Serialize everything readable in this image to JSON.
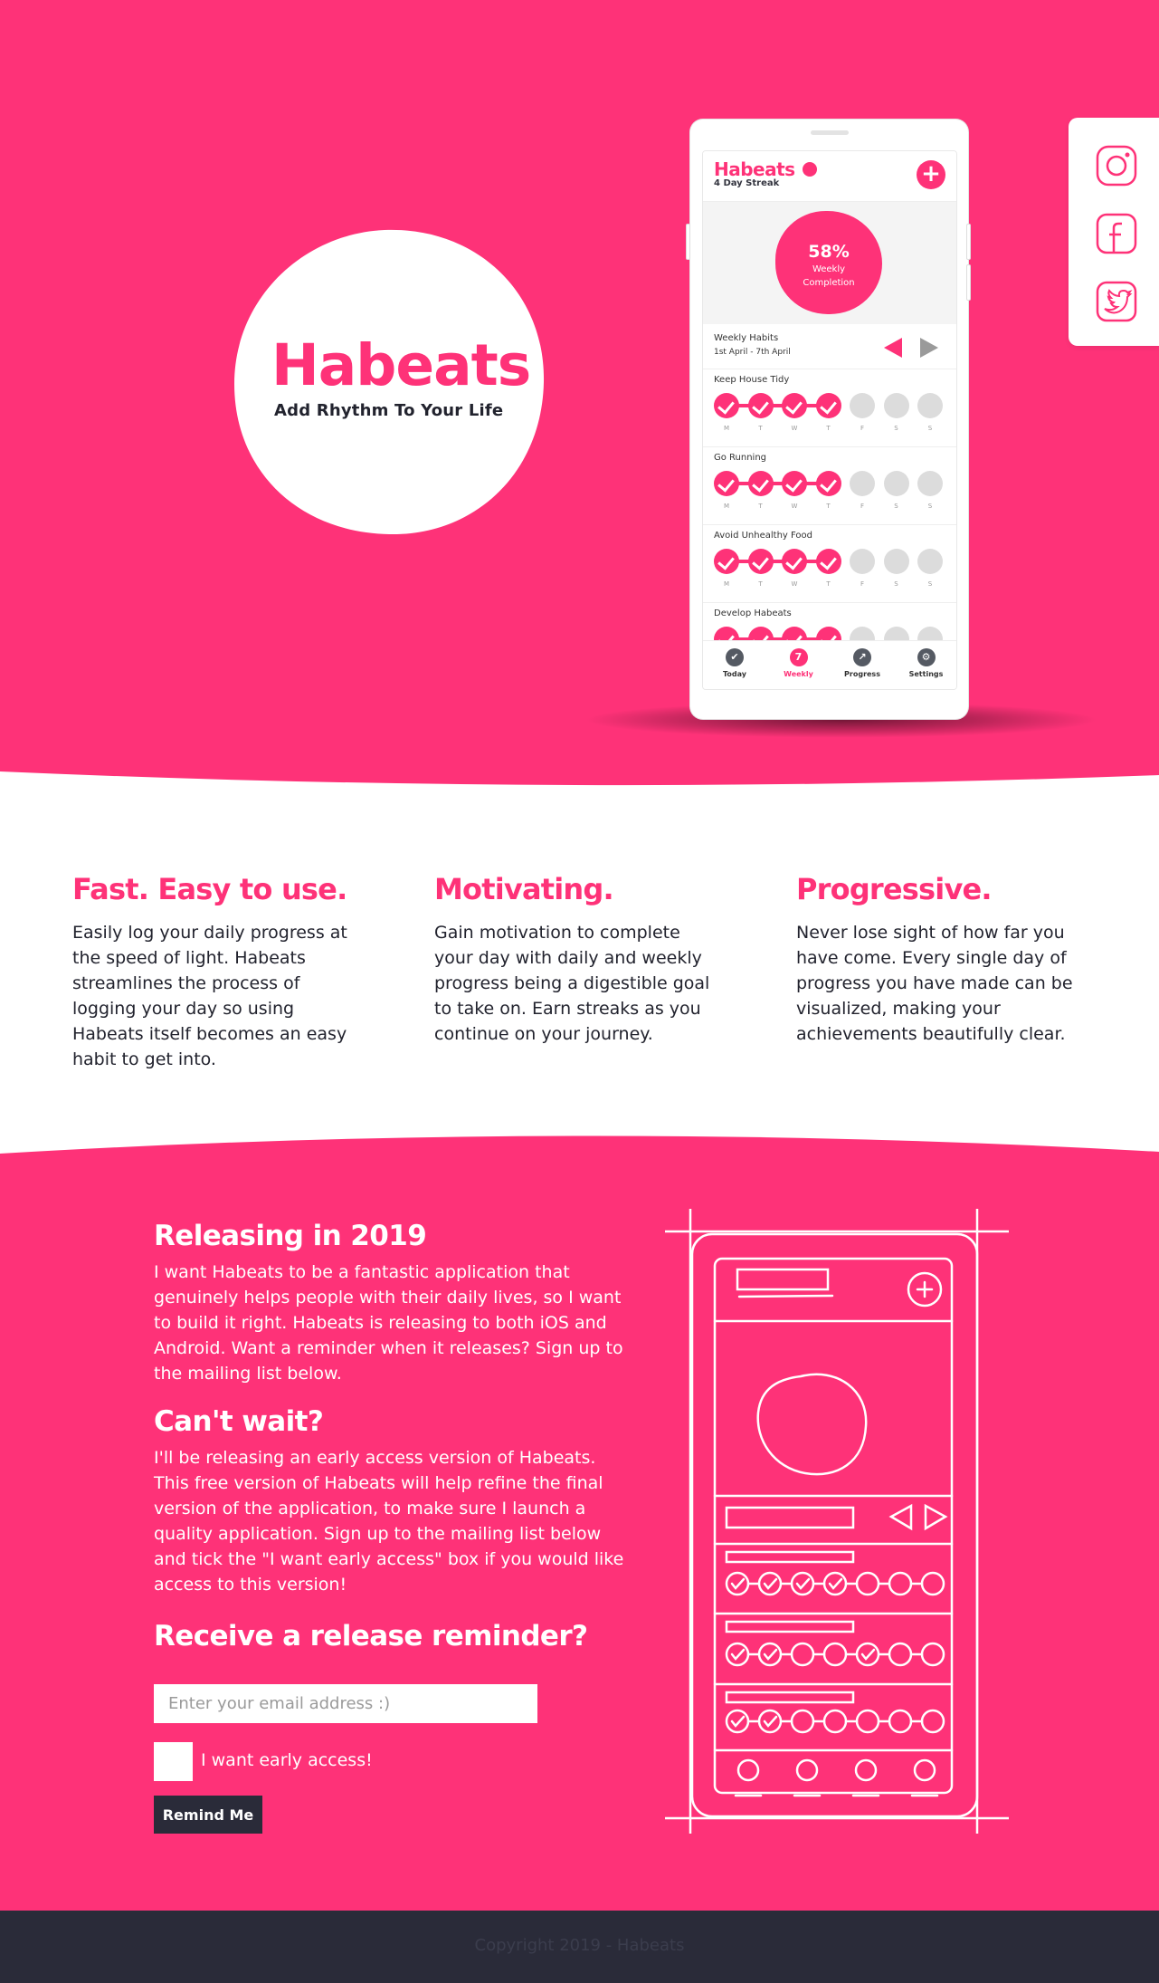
{
  "brand": {
    "name": "Habeats",
    "tagline": "Add Rhythm To Your Life"
  },
  "social": [
    {
      "icon": "instagram-icon"
    },
    {
      "icon": "facebook-icon"
    },
    {
      "icon": "twitter-icon"
    }
  ],
  "app": {
    "title": "Habeats",
    "streak": "4 Day Streak",
    "completion_value": "58%",
    "completion_label_1": "Weekly",
    "completion_label_2": "Completion",
    "weekly_title": "Weekly Habits",
    "weekly_range": "1st April - 7th April",
    "day_labels": [
      "M",
      "T",
      "W",
      "T",
      "F",
      "S",
      "S"
    ],
    "habits": [
      {
        "name": "Keep House Tidy",
        "done": [
          true,
          true,
          true,
          true,
          false,
          false,
          false
        ]
      },
      {
        "name": "Go Running",
        "done": [
          true,
          true,
          true,
          true,
          false,
          false,
          false
        ]
      },
      {
        "name": "Avoid Unhealthy Food",
        "done": [
          true,
          true,
          true,
          true,
          false,
          false,
          false
        ]
      },
      {
        "name": "Develop Habeats",
        "done": [
          true,
          true,
          true,
          true,
          false,
          false,
          false
        ]
      }
    ],
    "tabs": [
      {
        "label": "Today",
        "icon": "check-icon",
        "glyph": "✔"
      },
      {
        "label": "Weekly",
        "icon": "calendar-icon",
        "glyph": "7"
      },
      {
        "label": "Progress",
        "icon": "chart-icon",
        "glyph": "↗"
      },
      {
        "label": "Settings",
        "icon": "gear-icon",
        "glyph": "⚙"
      }
    ],
    "active_tab": "Weekly"
  },
  "features": [
    {
      "title": "Fast. Easy to use.",
      "text": "Easily log your daily progress at the speed of light. Habeats streamlines the process of logging your day so using Habeats itself becomes an easy habit to get into."
    },
    {
      "title": "Motivating.",
      "text": "Gain motivation to complete your day with daily and weekly progress being a digestible goal to take on. Earn streaks as you continue on your journey."
    },
    {
      "title": "Progressive.",
      "text": "Never lose sight of how far you have come. Every single day of progress you have made can be visualized, making your achievements beautifully clear."
    }
  ],
  "release": {
    "heading": "Releasing in 2019",
    "text": "I want Habeats to be a fantastic application that genuinely helps people with their daily lives, so I want to build it right. Habeats is releasing to both iOS and Android. Want a reminder when it releases? Sign up to the mailing list below.",
    "early_heading": "Can't wait?",
    "early_text": "I'll be releasing an early access version of Habeats. This free version of Habeats will help refine the final version of the application, to make sure I launch a quality application. Sign up to the mailing list below and tick the \"I want early access\" box if you would like access to this version!",
    "form_heading": "Receive a release reminder?",
    "email_placeholder": "Enter your email address :)",
    "checkbox_label": "I want early access!",
    "button_label": "Remind Me"
  },
  "footer": {
    "copyright": "Copyright 2019 - Habeats"
  },
  "colors": {
    "pink": "#fe3278",
    "dark": "#2a2b39"
  }
}
